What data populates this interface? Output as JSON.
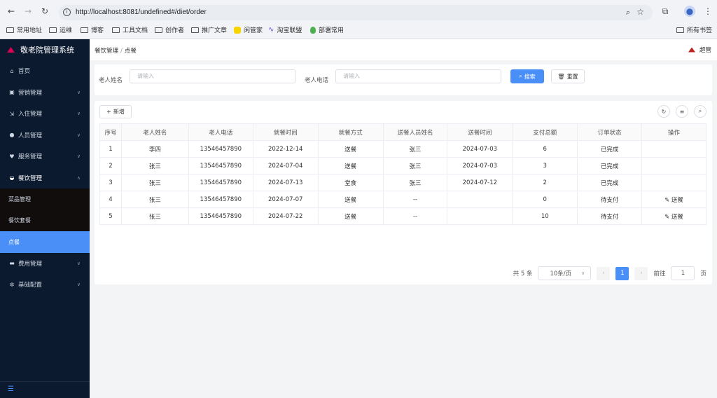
{
  "browser": {
    "url": "http://localhost:8081/undefined#/diet/order",
    "bookmarks": [
      "常用地址",
      "运维",
      "博客",
      "工具文档",
      "创作者",
      "推广文章",
      "闲管家",
      "淘宝联盟",
      "部署常用"
    ],
    "all_bookmarks": "所有书签"
  },
  "app": {
    "title": "敬老院管理系统"
  },
  "sidebar": {
    "items": [
      {
        "label": "首页",
        "icon": "home-icon"
      },
      {
        "label": "营销管理",
        "icon": "marketing-icon"
      },
      {
        "label": "入住管理",
        "icon": "checkin-icon"
      },
      {
        "label": "人员管理",
        "icon": "user-icon"
      },
      {
        "label": "服务管理",
        "icon": "heart-icon"
      },
      {
        "label": "餐饮管理",
        "icon": "dining-icon"
      }
    ],
    "subitems": [
      "菜品管理",
      "餐饮套餐",
      "点餐"
    ],
    "items_after": [
      {
        "label": "费用管理",
        "icon": "wallet-icon"
      },
      {
        "label": "基础配置",
        "icon": "gear-icon"
      }
    ]
  },
  "header": {
    "crumb1": "餐饮管理",
    "crumb2": "点餐",
    "user": "超管"
  },
  "search": {
    "name_label": "老人姓名",
    "name_placeholder": "请输入",
    "phone_label": "老人电话",
    "phone_placeholder": "请输入",
    "search_btn": "搜索",
    "reset_btn": "重置"
  },
  "table": {
    "add_btn": "新增",
    "headers": [
      "序号",
      "老人姓名",
      "老人电话",
      "就餐时间",
      "就餐方式",
      "送餐人员姓名",
      "送餐时间",
      "支付总额",
      "订单状态",
      "操作"
    ],
    "rows": [
      [
        "1",
        "李四",
        "13546457890",
        "2022-12-14",
        "送餐",
        "张三",
        "2024-07-03",
        "6",
        "已完成",
        ""
      ],
      [
        "2",
        "张三",
        "13546457890",
        "2024-07-04",
        "送餐",
        "张三",
        "2024-07-03",
        "3",
        "已完成",
        ""
      ],
      [
        "3",
        "张三",
        "13546457890",
        "2024-07-13",
        "堂食",
        "张三",
        "2024-07-12",
        "2",
        "已完成",
        ""
      ],
      [
        "4",
        "张三",
        "13546457890",
        "2024-07-07",
        "送餐",
        "--",
        "",
        "0",
        "待支付",
        "送餐"
      ],
      [
        "5",
        "张三",
        "13546457890",
        "2024-07-22",
        "送餐",
        "--",
        "",
        "10",
        "待支付",
        "送餐"
      ]
    ]
  },
  "pager": {
    "total": "共 5 条",
    "size": "10条/页",
    "current": "1",
    "goto": "前往",
    "page_input": "1",
    "page_unit": "页"
  }
}
